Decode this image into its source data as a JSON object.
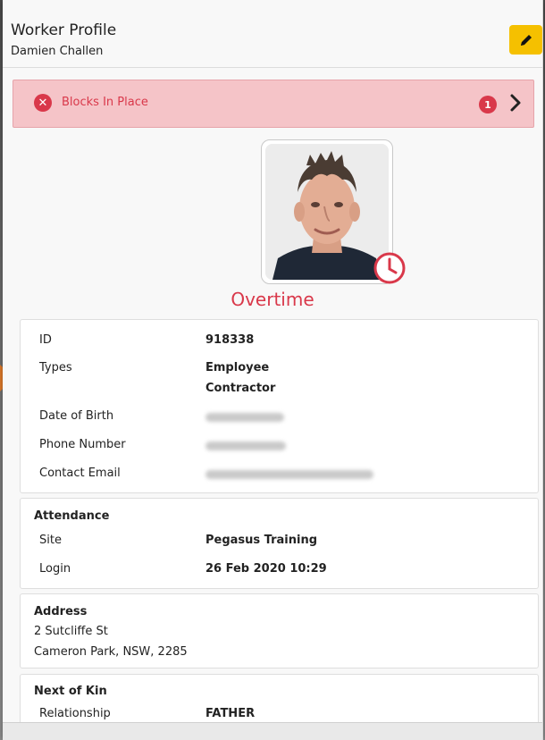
{
  "header": {
    "title": "Worker Profile",
    "subtitle": "Damien Challen"
  },
  "alert": {
    "text": "Blocks In Place",
    "count": "1"
  },
  "status": {
    "label": "Overtime"
  },
  "details": {
    "id_label": "ID",
    "id_value": "918338",
    "types_label": "Types",
    "types": [
      "Employee",
      "Contractor"
    ],
    "dob_label": "Date of Birth",
    "phone_label": "Phone Number",
    "email_label": "Contact Email"
  },
  "attendance": {
    "title": "Attendance",
    "site_label": "Site",
    "site_value": "Pegasus Training",
    "login_label": "Login",
    "login_value": "26 Feb 2020 10:29"
  },
  "address": {
    "title": "Address",
    "line1": "2 Sutcliffe St",
    "line2": "Cameron Park, NSW, 2285"
  },
  "next_of_kin": {
    "title": "Next of Kin",
    "relationship_label": "Relationship",
    "relationship_value": "FATHER"
  },
  "colors": {
    "accent_yellow": "#f5c000",
    "alert_red": "#d9384a",
    "alert_bg": "#f5c4c8",
    "pointer_orange": "#e07b2a"
  },
  "icons": [
    "pencil-icon",
    "close-circle-icon",
    "chevron-right-icon",
    "clock-icon"
  ]
}
